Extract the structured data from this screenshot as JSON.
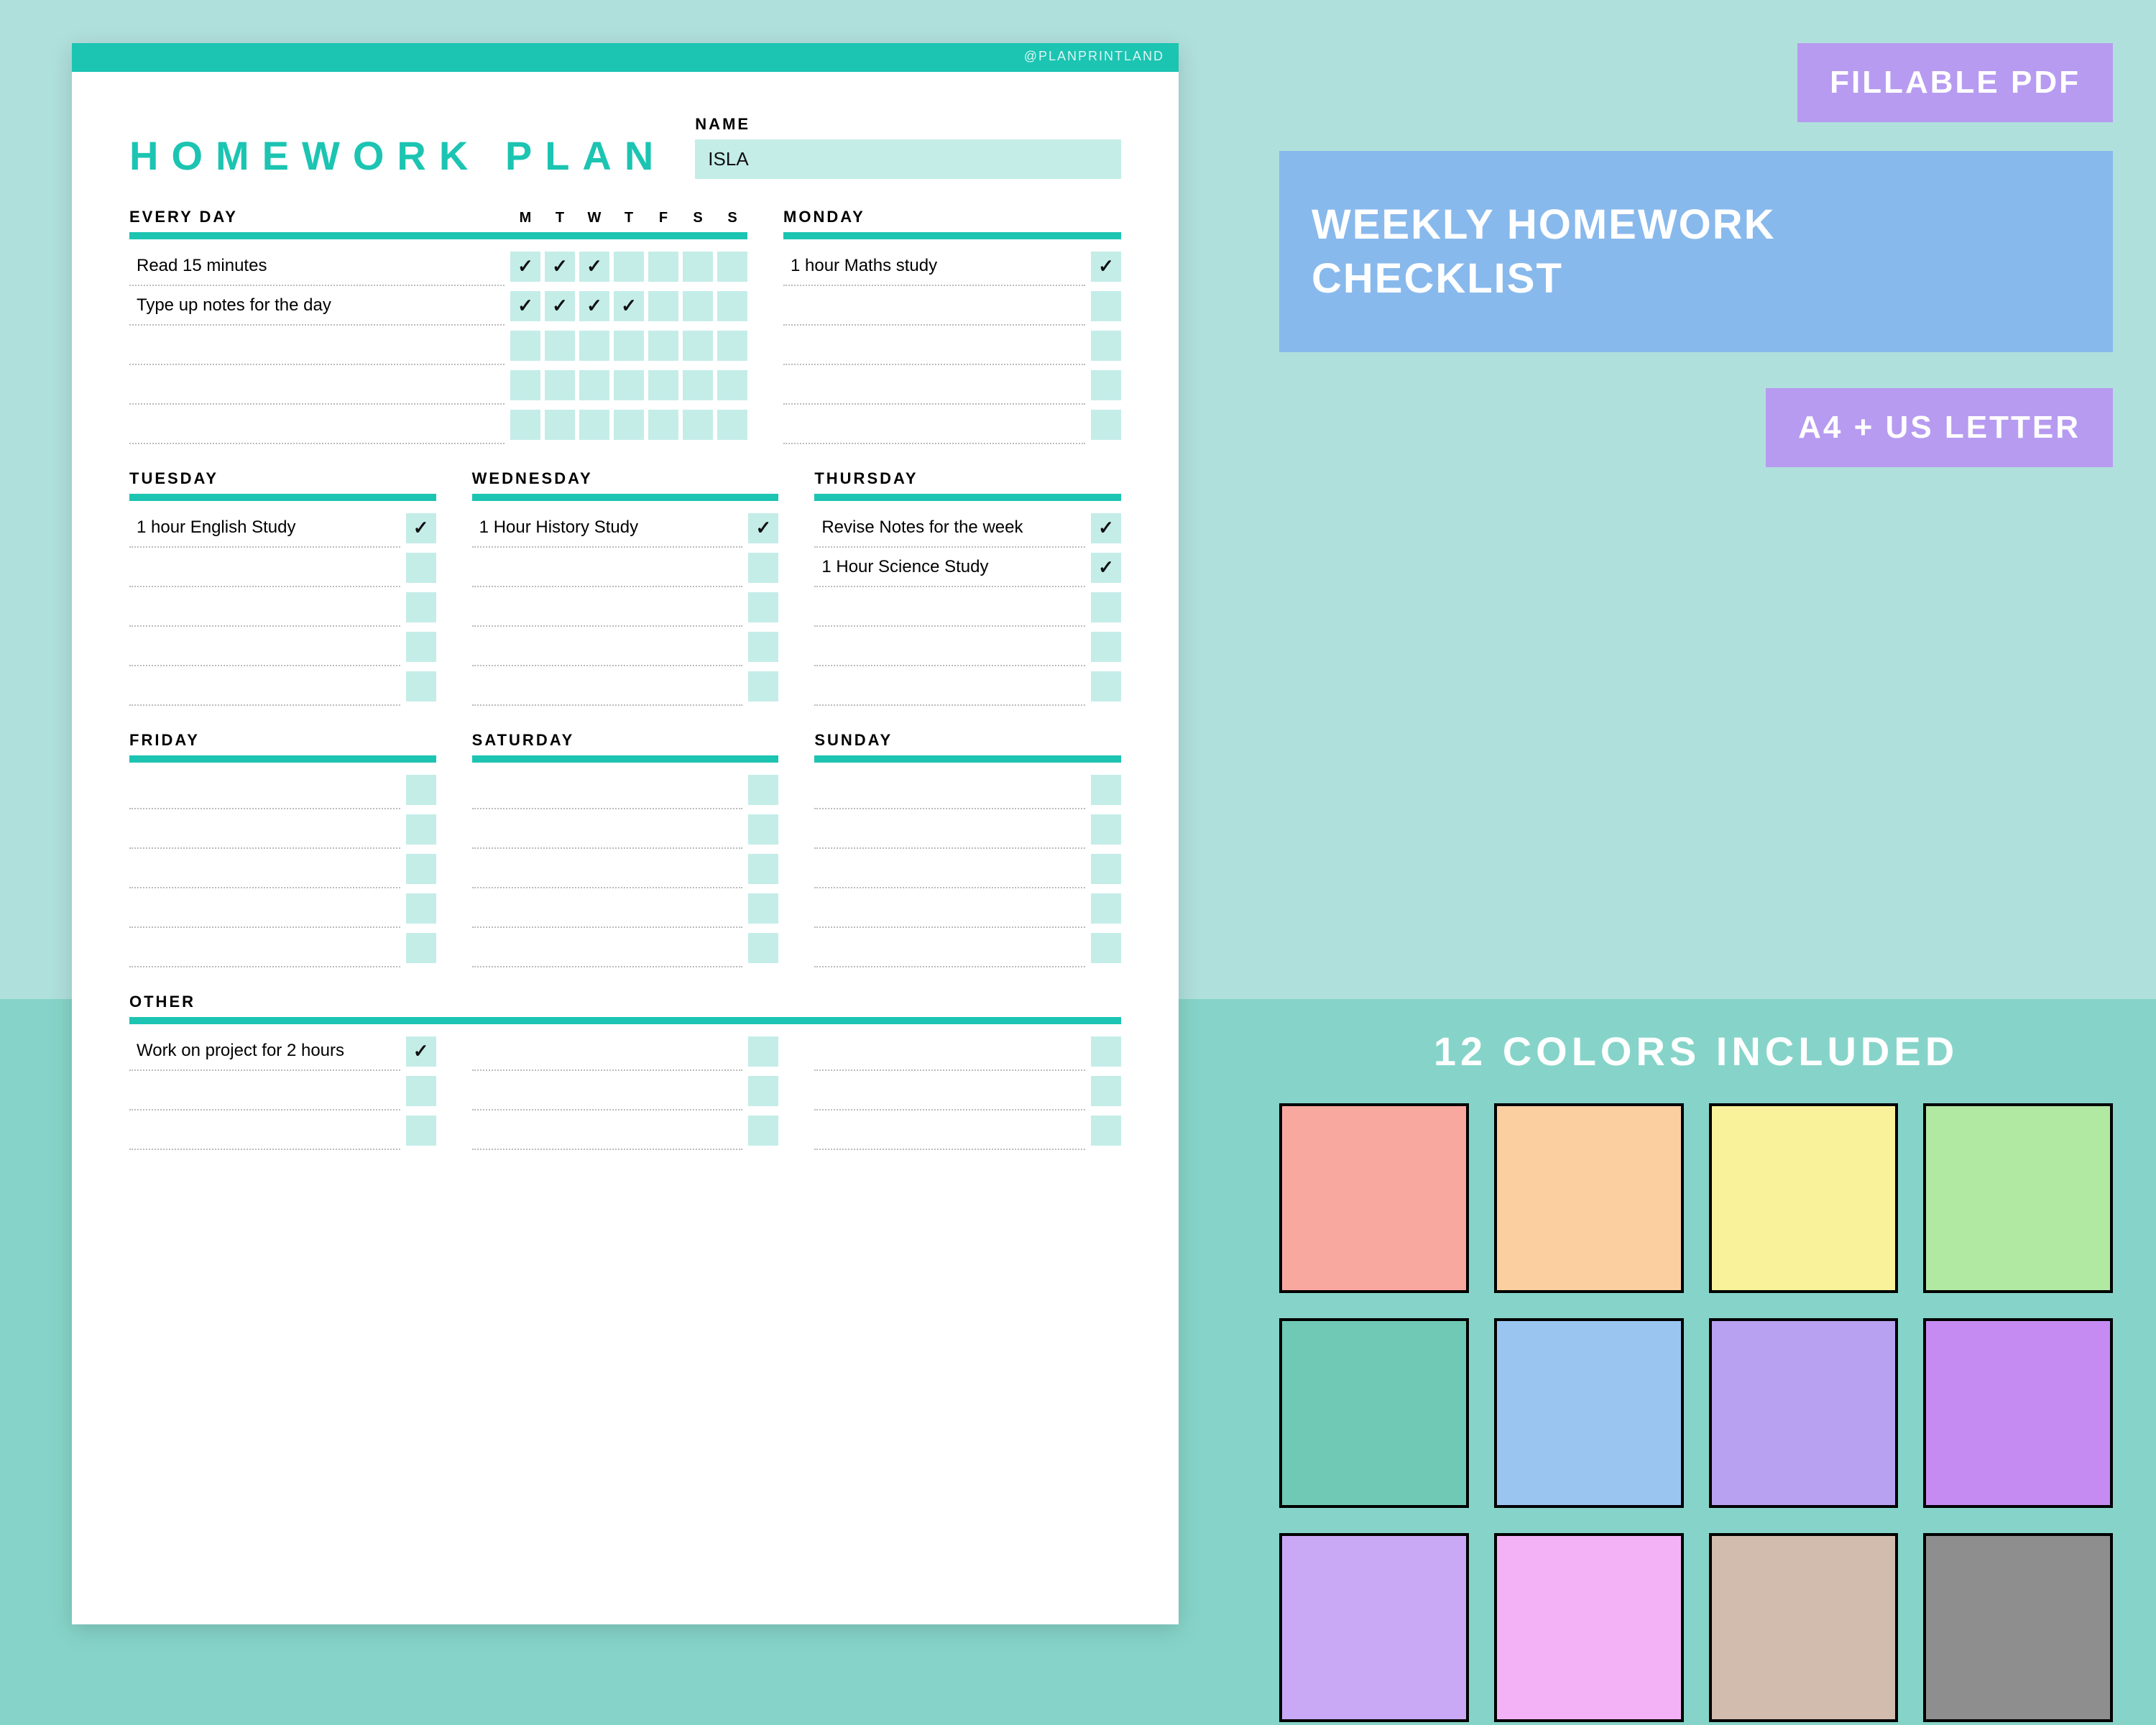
{
  "brand": "@PLANPRINTLAND",
  "page": {
    "title": "HOMEWORK PLAN",
    "name_label": "NAME",
    "name_value": "ISLA",
    "accent": "#1cc4b2",
    "box_color": "#c4ede8"
  },
  "everyday": {
    "heading": "EVERY DAY",
    "day_letters": [
      "M",
      "T",
      "W",
      "T",
      "F",
      "S",
      "S"
    ],
    "rows": [
      {
        "text": "Read 15 minutes",
        "checks": [
          true,
          true,
          true,
          false,
          false,
          false,
          false
        ]
      },
      {
        "text": "Type up notes for the day",
        "checks": [
          true,
          true,
          true,
          true,
          false,
          false,
          false
        ]
      },
      {
        "text": "",
        "checks": [
          false,
          false,
          false,
          false,
          false,
          false,
          false
        ]
      },
      {
        "text": "",
        "checks": [
          false,
          false,
          false,
          false,
          false,
          false,
          false
        ]
      },
      {
        "text": "",
        "checks": [
          false,
          false,
          false,
          false,
          false,
          false,
          false
        ]
      }
    ]
  },
  "days": {
    "monday": {
      "heading": "MONDAY",
      "rows": [
        {
          "text": "1 hour Maths study",
          "check": true
        },
        {
          "text": "",
          "check": false
        },
        {
          "text": "",
          "check": false
        },
        {
          "text": "",
          "check": false
        },
        {
          "text": "",
          "check": false
        }
      ]
    },
    "tuesday": {
      "heading": "TUESDAY",
      "rows": [
        {
          "text": "1 hour English Study",
          "check": true
        },
        {
          "text": "",
          "check": false
        },
        {
          "text": "",
          "check": false
        },
        {
          "text": "",
          "check": false
        },
        {
          "text": "",
          "check": false
        }
      ]
    },
    "wednesday": {
      "heading": "WEDNESDAY",
      "rows": [
        {
          "text": "1 Hour History Study",
          "check": true
        },
        {
          "text": "",
          "check": false
        },
        {
          "text": "",
          "check": false
        },
        {
          "text": "",
          "check": false
        },
        {
          "text": "",
          "check": false
        }
      ]
    },
    "thursday": {
      "heading": "THURSDAY",
      "rows": [
        {
          "text": "Revise Notes for the week",
          "check": true
        },
        {
          "text": "1 Hour Science Study",
          "check": true
        },
        {
          "text": "",
          "check": false
        },
        {
          "text": "",
          "check": false
        },
        {
          "text": "",
          "check": false
        }
      ]
    },
    "friday": {
      "heading": "FRIDAY",
      "rows": [
        {
          "text": "",
          "check": false
        },
        {
          "text": "",
          "check": false
        },
        {
          "text": "",
          "check": false
        },
        {
          "text": "",
          "check": false
        },
        {
          "text": "",
          "check": false
        }
      ]
    },
    "saturday": {
      "heading": "SATURDAY",
      "rows": [
        {
          "text": "",
          "check": false
        },
        {
          "text": "",
          "check": false
        },
        {
          "text": "",
          "check": false
        },
        {
          "text": "",
          "check": false
        },
        {
          "text": "",
          "check": false
        }
      ]
    },
    "sunday": {
      "heading": "SUNDAY",
      "rows": [
        {
          "text": "",
          "check": false
        },
        {
          "text": "",
          "check": false
        },
        {
          "text": "",
          "check": false
        },
        {
          "text": "",
          "check": false
        },
        {
          "text": "",
          "check": false
        }
      ]
    }
  },
  "other": {
    "heading": "OTHER",
    "cols": [
      [
        {
          "text": "Work on project for 2 hours",
          "check": true
        },
        {
          "text": "",
          "check": false
        },
        {
          "text": "",
          "check": false
        }
      ],
      [
        {
          "text": "",
          "check": false
        },
        {
          "text": "",
          "check": false
        },
        {
          "text": "",
          "check": false
        }
      ],
      [
        {
          "text": "",
          "check": false
        },
        {
          "text": "",
          "check": false
        },
        {
          "text": "",
          "check": false
        }
      ]
    ]
  },
  "badges": {
    "fillable": "FILLABLE PDF",
    "main1": "WEEKLY HOMEWORK",
    "main2": "CHECKLIST",
    "size": "A4 + US LETTER"
  },
  "palette": {
    "title": "12 COLORS INCLUDED",
    "colors": [
      "#f9a8a0",
      "#fbcfa0",
      "#f9f29b",
      "#b1e8a2",
      "#6fc9b5",
      "#9ac5f0",
      "#b8a1f0",
      "#c68bf2",
      "#c9a8f5",
      "#f3b2f5",
      "#d1bcae",
      "#8e8e8e"
    ]
  }
}
